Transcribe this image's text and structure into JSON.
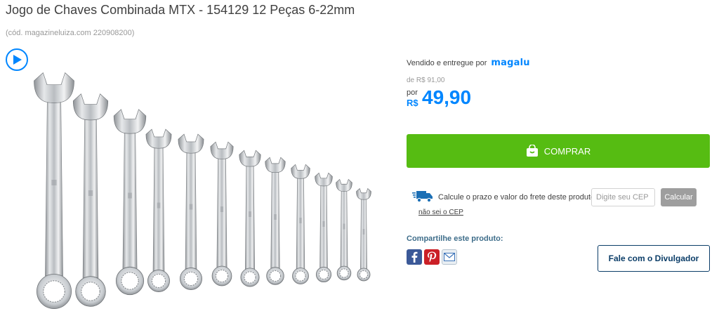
{
  "product": {
    "title": "Jogo de Chaves Combinada MTX - 154129 12 Peças 6-22mm",
    "sku": "(cód. magazineluiza.com 220908200)"
  },
  "media": {
    "play_icon": "play-icon",
    "image_alt": "Jogo de chaves combinadas MTX 12 peças"
  },
  "seller": {
    "label": "Vendido e entregue por",
    "brand": "magalu",
    "brand_color": "#0086ff"
  },
  "pricing": {
    "old_price": "de R$ 91,00",
    "por_label": "por",
    "currency": "R$",
    "price": "49,90",
    "price_color": "#0086ff"
  },
  "buy": {
    "label": "COMPRAR",
    "icon": "shopping-bag-icon",
    "color": "#56bc12"
  },
  "shipping": {
    "icon": "delivery-truck-icon",
    "label": "Calcule o prazo e valor do frete deste produto:",
    "cep_placeholder": "Digite seu CEP",
    "calc_label": "Calcular",
    "unknown_cep_link": "não sei o CEP"
  },
  "share": {
    "title": "Compartilhe este produto:",
    "icons": [
      "facebook-icon",
      "pinterest-icon",
      "email-icon"
    ]
  },
  "contact": {
    "label": "Fale com o Divulgador"
  }
}
